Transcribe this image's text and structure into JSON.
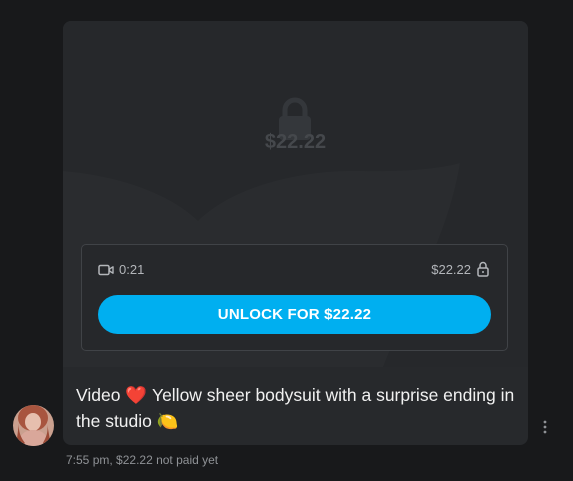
{
  "message": {
    "media": {
      "type_icon": "video-camera-icon",
      "duration": "0:21",
      "price": "$22.22",
      "locked": true,
      "overlay_price": "$22.22",
      "unlock_button_label": "UNLOCK FOR $22.22"
    },
    "caption": {
      "prefix": "Video",
      "emoji_heart": "❤️",
      "text": "Yellow sheer bodysuit with a surprise ending in the studio",
      "emoji_lemon": "🍋"
    },
    "meta": {
      "time": "7:55 pm,",
      "status": "$22.22 not paid yet"
    }
  },
  "icons": {
    "lock": "lock-icon",
    "more": "more-vertical-icon",
    "avatar": "sender-avatar"
  },
  "colors": {
    "background": "#18191b",
    "bubble": "#27292c",
    "accent": "#00aff0",
    "muted_text": "#8f9296"
  }
}
